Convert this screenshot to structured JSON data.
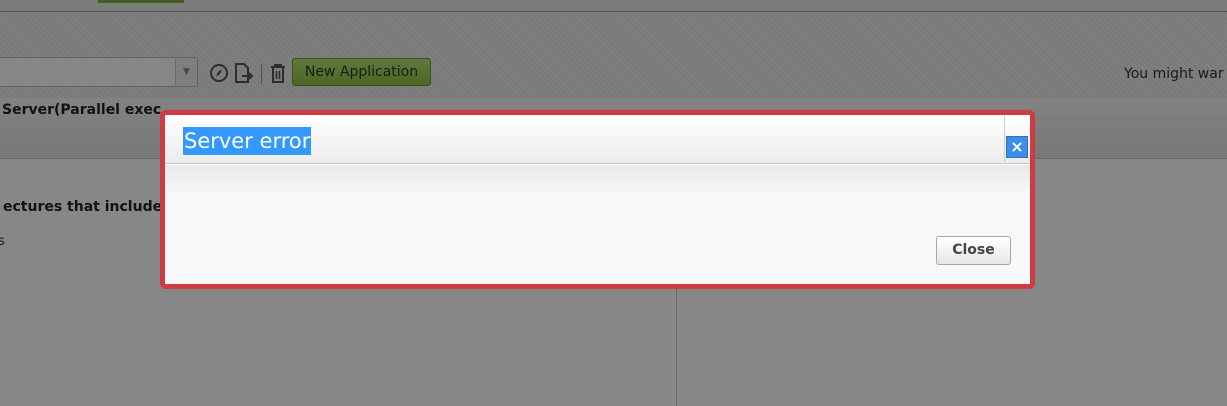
{
  "toolbar": {
    "new_application_label": "New Application",
    "hint_text": "You might war",
    "icons": [
      "compass-icon",
      "export-file-icon",
      "trash-icon"
    ]
  },
  "header": {
    "title": "Server(Parallel exec"
  },
  "content": {
    "description_bold": "ectures that include",
    "description_line2": "s"
  },
  "dialog": {
    "title": "Server error",
    "close_x": "×",
    "close_button_label": "Close"
  },
  "colors": {
    "dialog_border": "#cc3c43",
    "title_highlight": "#3399ff",
    "new_app_button": "#8dc63f"
  }
}
